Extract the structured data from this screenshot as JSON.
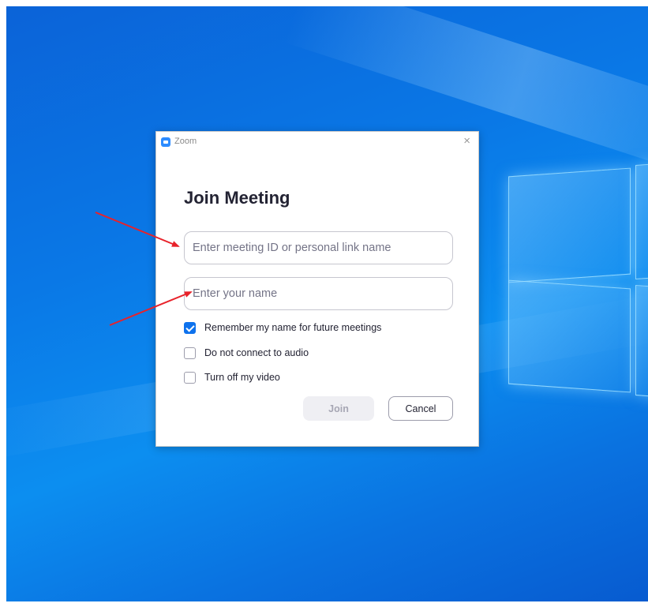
{
  "window": {
    "app_title": "Zoom",
    "close_glyph": "×",
    "icon": "zoom-logo-icon"
  },
  "dialog": {
    "heading": "Join Meeting",
    "meeting_id_placeholder": "Enter meeting ID or personal link name",
    "name_placeholder": "Enter your name",
    "options": [
      {
        "label": "Remember my name for future meetings",
        "checked": true
      },
      {
        "label": "Do not connect to audio",
        "checked": false
      },
      {
        "label": "Turn off my video",
        "checked": false
      }
    ],
    "join_label": "Join",
    "cancel_label": "Cancel"
  },
  "annotations": {
    "arrow_color": "#e8222a"
  },
  "colors": {
    "accent": "#0e72ed",
    "desktop_blue": "#0a78e6"
  }
}
